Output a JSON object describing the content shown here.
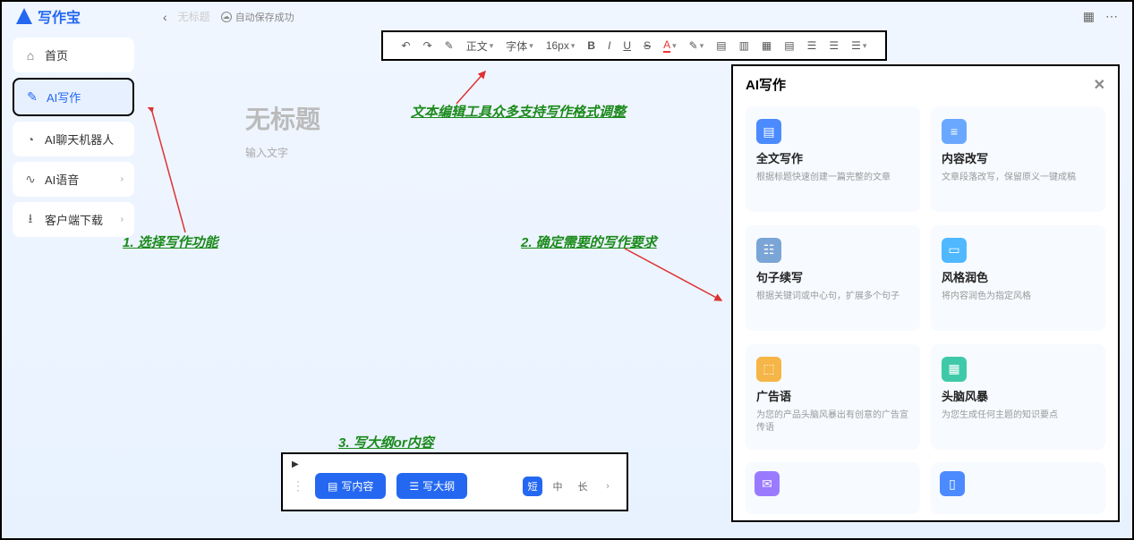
{
  "app": {
    "name": "写作宝"
  },
  "header": {
    "back": "‹",
    "doc_title": "无标题",
    "autosave": "自动保存成功"
  },
  "sidebar": {
    "items": [
      {
        "icon": "home",
        "label": "首页",
        "chevron": false
      },
      {
        "icon": "edit",
        "label": "AI写作",
        "chevron": false
      },
      {
        "icon": "chat",
        "label": "AI聊天机器人",
        "chevron": false
      },
      {
        "icon": "audio",
        "label": "AI语音",
        "chevron": true
      },
      {
        "icon": "download",
        "label": "客户端下载",
        "chevron": true
      }
    ]
  },
  "toolbar": {
    "undo": "↶",
    "redo": "↷",
    "format_paint": "✎",
    "paragraph": "正文",
    "font": "字体",
    "size": "16px",
    "bold": "B",
    "italic": "I",
    "underline": "U",
    "strike": "S",
    "font_color": "A",
    "highlight": "✎",
    "align_left": "≡",
    "align_center": "≡",
    "align_right": "≡",
    "align_justify": "≡",
    "list_ol": "≡",
    "list_ul": "≡",
    "indent": "≡"
  },
  "editor": {
    "title_placeholder": "无标题",
    "body_placeholder": "输入文字"
  },
  "bottombar": {
    "write_content": "写内容",
    "write_outline": "写大纲",
    "len_short": "短",
    "len_mid": "中",
    "len_long": "长"
  },
  "ai_panel": {
    "title": "AI写作",
    "cards": [
      {
        "title": "全文写作",
        "desc": "根据标题快速创建一篇完整的文章",
        "color": "#4b8bff"
      },
      {
        "title": "内容改写",
        "desc": "文章段落改写，保留原义一键成稿",
        "color": "#6aa8ff"
      },
      {
        "title": "句子续写",
        "desc": "根据关键词或中心句，扩展多个句子",
        "color": "#7aa5d6"
      },
      {
        "title": "风格润色",
        "desc": "将内容润色为指定风格",
        "color": "#4fb8ff"
      },
      {
        "title": "广告语",
        "desc": "为您的产品头脑风暴出有创意的广告宣传语",
        "color": "#f5b547"
      },
      {
        "title": "头脑风暴",
        "desc": "为您生成任何主题的知识要点",
        "color": "#3fc9a8"
      }
    ],
    "extra": [
      {
        "color": "#9a7bff"
      },
      {
        "color": "#4b8bff"
      }
    ]
  },
  "annotations": {
    "a1": "1. 选择写作功能",
    "a2": "文本编辑工具众多支持写作格式调整",
    "a3": "2. 确定需要的写作要求",
    "a4": "3. 写大纲or内容"
  }
}
